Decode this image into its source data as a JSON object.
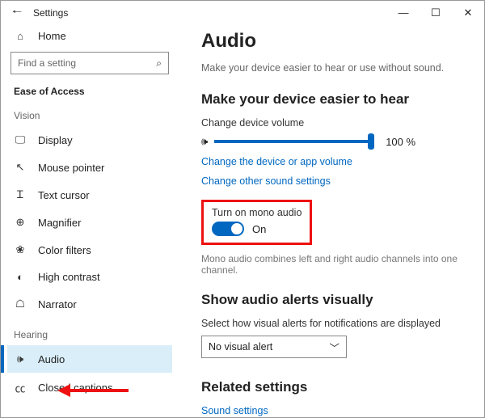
{
  "window": {
    "title": "Settings"
  },
  "sidebar": {
    "home": "Home",
    "search_placeholder": "Find a setting",
    "category": "Ease of Access",
    "groups": {
      "vision": {
        "label": "Vision",
        "items": [
          "Display",
          "Mouse pointer",
          "Text cursor",
          "Magnifier",
          "Color filters",
          "High contrast",
          "Narrator"
        ]
      },
      "hearing": {
        "label": "Hearing",
        "items": [
          "Audio",
          "Closed captions"
        ]
      }
    }
  },
  "main": {
    "heading": "Audio",
    "description": "Make your device easier to hear or use without sound.",
    "section1": {
      "title": "Make your device easier to hear",
      "volume_label": "Change device volume",
      "volume_value": "100 %",
      "link_device_app": "Change the device or app volume",
      "link_other": "Change other sound settings",
      "mono_label": "Turn on mono audio",
      "mono_state": "On",
      "mono_hint": "Mono audio combines left and right audio channels into one channel."
    },
    "section2": {
      "title": "Show audio alerts visually",
      "select_label": "Select how visual alerts for notifications are displayed",
      "select_value": "No visual alert"
    },
    "section3": {
      "title": "Related settings",
      "link_sound": "Sound settings"
    }
  }
}
